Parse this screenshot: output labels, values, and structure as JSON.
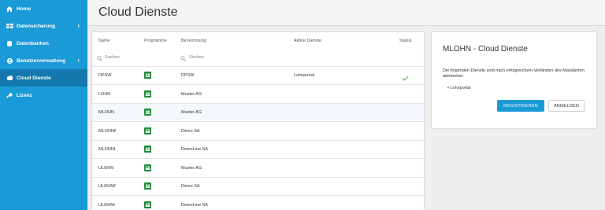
{
  "sidebar": {
    "items": [
      {
        "label": "Home",
        "icon": "home-icon"
      },
      {
        "label": "Datensicherung",
        "icon": "backup-icon"
      },
      {
        "label": "Datenbanken",
        "icon": "database-icon"
      },
      {
        "label": "Benutzerverwaltung",
        "icon": "user-icon"
      },
      {
        "label": "Cloud Dienste",
        "icon": "cloud-icon"
      },
      {
        "label": "Lizenz",
        "icon": "key-icon"
      }
    ]
  },
  "header": {
    "title": "Cloud Dienste"
  },
  "table": {
    "columns": {
      "name": "Name",
      "programme": "Programme",
      "bezeichnung": "Bezeichnung",
      "dienste": "Aktive Dienste",
      "status": "Status"
    },
    "search_placeholder": "Suchen",
    "rows": [
      {
        "name": "DPSW",
        "bezeichnung": "DPSW",
        "dienste": "Lohnportal",
        "status": "✓"
      },
      {
        "name": "LOHN",
        "bezeichnung": "Muster AG",
        "dienste": "",
        "status": ""
      },
      {
        "name": "MLOHN",
        "bezeichnung": "Muster AG",
        "dienste": "",
        "status": ""
      },
      {
        "name": "MLOHNF",
        "bezeichnung": "Démo SA",
        "dienste": "",
        "status": ""
      },
      {
        "name": "MLOHNI",
        "bezeichnung": "DemoLine SA",
        "dienste": "",
        "status": ""
      },
      {
        "name": "ULOHN",
        "bezeichnung": "Muster AG",
        "dienste": "",
        "status": ""
      },
      {
        "name": "ULOHNF",
        "bezeichnung": "Démo SA",
        "dienste": "",
        "status": ""
      },
      {
        "name": "ULOHNI",
        "bezeichnung": "DemoLine SA",
        "dienste": "",
        "status": ""
      }
    ]
  },
  "detail": {
    "title": "MLOHN - Cloud Dienste",
    "text": "Die folgenden Dienste sind nach erfolgreichem Verbinden des Mandanten aktivierbar:",
    "list_item": "Lohnportal",
    "register_label": "REGISTRIEREN",
    "login_label": "ANMELDEN"
  },
  "colors": {
    "sidebar": "#1a9ad6",
    "sidebar_active": "#1478ad",
    "primary": "#1a9ad6",
    "program_badge": "#1e8b3a",
    "status_ok": "#4caf50"
  }
}
